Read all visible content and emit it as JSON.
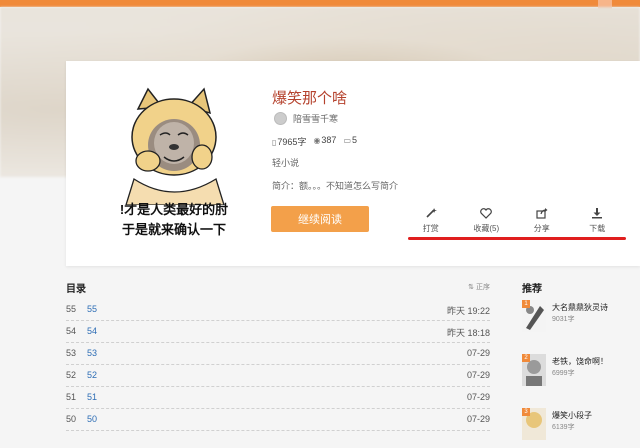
{
  "book": {
    "title": "爆笑那个啥",
    "author": "陪雪雪千寒",
    "word_count": "7965字",
    "views": "387",
    "comments": "5",
    "genre": "轻小说",
    "intro": "简介：额。。。不知道怎么写简介",
    "cover_caption_1": "!才是人类最好的肘",
    "cover_caption_2": "于是就来确认一下"
  },
  "actions": {
    "read_label": "继续阅读",
    "tip_label": "打赏",
    "favorite_label": "收藏(5)",
    "share_label": "分享",
    "download_label": "下载"
  },
  "toc": {
    "title": "目录",
    "sort_label": "正序",
    "rows": [
      {
        "num": "55",
        "chapter": "55",
        "date": "昨天 19:22"
      },
      {
        "num": "54",
        "chapter": "54",
        "date": "昨天 18:18"
      },
      {
        "num": "53",
        "chapter": "53",
        "date": "07-29"
      },
      {
        "num": "52",
        "chapter": "52",
        "date": "07-29"
      },
      {
        "num": "51",
        "chapter": "51",
        "date": "07-29"
      },
      {
        "num": "50",
        "chapter": "50",
        "date": "07-29"
      }
    ]
  },
  "recommend": {
    "title": "推荐",
    "items": [
      {
        "rank": "1",
        "title": "大名鼎鼎狄灵诗",
        "count": "9031字"
      },
      {
        "rank": "2",
        "title": "老铁，饶命啊！",
        "count": "6999字"
      },
      {
        "rank": "3",
        "title": "爆笑小段子",
        "count": "6139字"
      }
    ]
  },
  "colors": {
    "accent": "#f08a3a",
    "button": "#f3a04a",
    "title": "#b5422d",
    "link": "#2d6db5",
    "annotation": "#e01e1e"
  }
}
